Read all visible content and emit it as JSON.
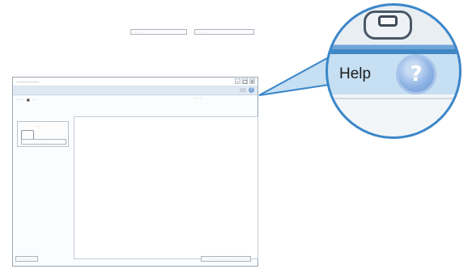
{
  "window": {
    "title": "...................",
    "controls": [
      "–",
      "□",
      "×"
    ]
  },
  "ribbon": {
    "help_glyph": "?"
  },
  "toolbar": {
    "items": [
      "· · · ·",
      "■",
      "· ·"
    ],
    "right_label": "· · · ·"
  },
  "sidebar": {
    "device_label": "· ·",
    "device_sub": "· · · ·"
  },
  "main": {
    "dropdown_1": "· · · · · · · ·",
    "dropdown_2": "· · · · · · · ·"
  },
  "bottom": {
    "left_button": "· · ·",
    "right_button": "· · · · ·"
  },
  "callout": {
    "label": "Help",
    "icon_glyph": "?",
    "accent_color": "#3b86c9"
  }
}
